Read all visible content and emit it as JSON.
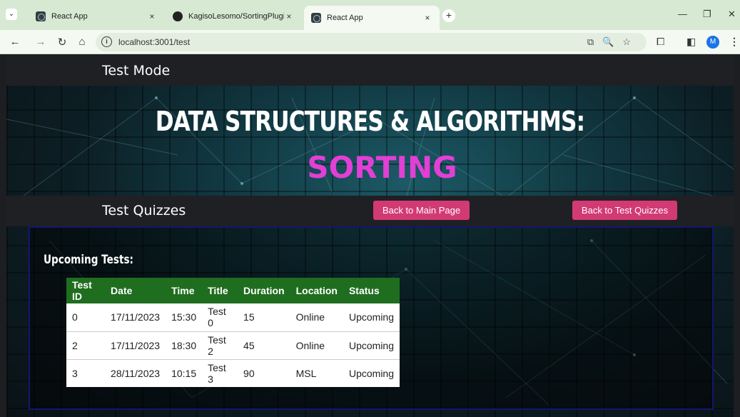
{
  "browser": {
    "tabs": [
      {
        "title": "React App",
        "close": "×"
      },
      {
        "title": "KagisoLesomo/SortingPlugin a",
        "close": "×"
      },
      {
        "title": "React App",
        "close": "×"
      }
    ],
    "new_tab": "+",
    "url": "localhost:3001/test",
    "profile_initial": "M"
  },
  "page": {
    "topnav_title": "Test Mode",
    "hero_title": "DATA STRUCTURES & ALGORITHMS:",
    "hero_subtitle": "SORTING",
    "subnav_title": "Test Quizzes",
    "back_main_label": "Back to Main Page",
    "back_quizzes_label": "Back to Test Quizzes",
    "upcoming_heading": "Upcoming Tests:",
    "colors": {
      "accent": "#d23a74",
      "table_header": "#1f6e1f",
      "subtitle": "#e23fd6"
    }
  },
  "table": {
    "headers": [
      "Test ID",
      "Date",
      "Time",
      "Title",
      "Duration",
      "Location",
      "Status"
    ],
    "rows": [
      [
        "0",
        "17/11/2023",
        "15:30",
        "Test 0",
        "15",
        "Online",
        "Upcoming"
      ],
      [
        "2",
        "17/11/2023",
        "18:30",
        "Test 2",
        "45",
        "Online",
        "Upcoming"
      ],
      [
        "3",
        "28/11/2023",
        "10:15",
        "Test 3",
        "90",
        "MSL",
        "Upcoming"
      ]
    ]
  }
}
